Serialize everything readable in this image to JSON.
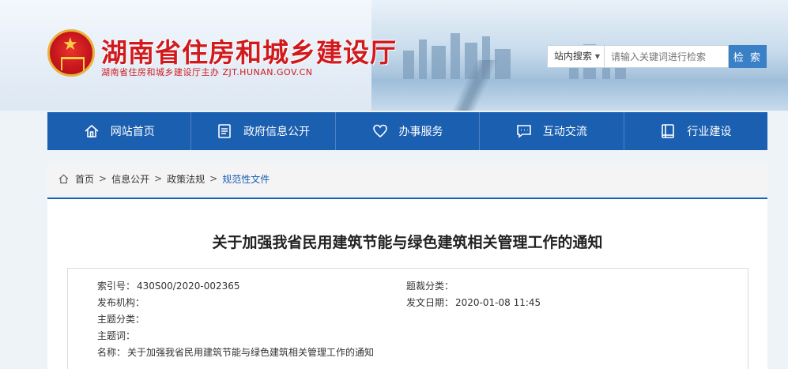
{
  "header": {
    "site_title": "湖南省住房和城乡建设厅",
    "site_subtitle": "湖南省住房和城乡建设厅主办  ZJT.HUNAN.GOV.CN",
    "search": {
      "scope": "站内搜索",
      "placeholder": "请输入关键词进行检索",
      "button": "检 索"
    }
  },
  "nav": [
    {
      "label": "网站首页",
      "icon": "home-icon"
    },
    {
      "label": "政府信息公开",
      "icon": "document-icon"
    },
    {
      "label": "办事服务",
      "icon": "heart-icon"
    },
    {
      "label": "互动交流",
      "icon": "chat-icon"
    },
    {
      "label": "行业建设",
      "icon": "book-icon"
    }
  ],
  "breadcrumb": {
    "items": [
      "首页",
      "信息公开",
      "政策法规"
    ],
    "current": "规范性文件",
    "separator": ">"
  },
  "article": {
    "title": "关于加强我省民用建筑节能与绿色建筑相关管理工作的通知",
    "meta": {
      "index_label": "索引号：",
      "index_value": "430S00/2020-002365",
      "topic_class_label": "题裁分类：",
      "topic_class_value": "",
      "publisher_label": "发布机构：",
      "publisher_value": "",
      "issue_date_label": "发文日期：",
      "issue_date_value": "2020-01-08 11:45",
      "subject_label": "主题分类：",
      "subject_value": "",
      "keyword_label": "主题词：",
      "keyword_value": "",
      "name_label": "名称：",
      "name_value": "关于加强我省民用建筑节能与绿色建筑相关管理工作的通知"
    }
  },
  "colors": {
    "brand_red": "#d01a1d",
    "nav_blue": "#1b5fb1",
    "search_blue": "#3a80c6",
    "link_blue": "#1b5fb1"
  }
}
